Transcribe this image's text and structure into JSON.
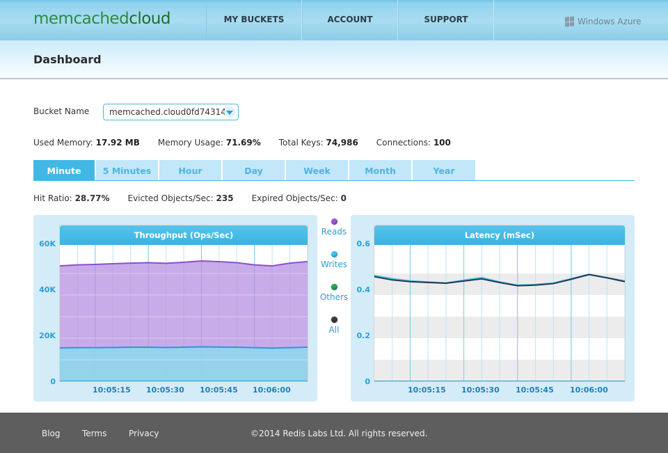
{
  "header": {
    "logo_part1": "memcached",
    "logo_part2": "cloud",
    "nav": [
      {
        "label": "MY BUCKETS"
      },
      {
        "label": "ACCOUNT"
      },
      {
        "label": "SUPPORT"
      }
    ],
    "partner": "Windows Azure"
  },
  "page": {
    "title": "Dashboard"
  },
  "bucket": {
    "label": "Bucket Name",
    "selected": "memcached.cloud0fd74314-"
  },
  "stats": {
    "used_memory_label": "Used Memory:",
    "used_memory_value": "17.92 MB",
    "memory_usage_label": "Memory Usage:",
    "memory_usage_value": "71.69%",
    "total_keys_label": "Total Keys:",
    "total_keys_value": "74,986",
    "connections_label": "Connections:",
    "connections_value": "100"
  },
  "tabs": [
    {
      "label": "Minute",
      "active": true
    },
    {
      "label": "5 Minutes",
      "active": false
    },
    {
      "label": "Hour",
      "active": false
    },
    {
      "label": "Day",
      "active": false
    },
    {
      "label": "Week",
      "active": false
    },
    {
      "label": "Month",
      "active": false
    },
    {
      "label": "Year",
      "active": false
    }
  ],
  "ratios": {
    "hit_ratio_label": "Hit Ratio:",
    "hit_ratio_value": "28.77%",
    "evicted_label": "Evicted Objects/Sec:",
    "evicted_value": "235",
    "expired_label": "Expired Objects/Sec:",
    "expired_value": "0"
  },
  "legend": [
    {
      "label": "Reads",
      "color": "#9b59d6"
    },
    {
      "label": "Writes",
      "color": "#3cc4ec"
    },
    {
      "label": "Others",
      "color": "#27a55b"
    },
    {
      "label": "All",
      "color": "#3a3a3a"
    }
  ],
  "chart_data": [
    {
      "type": "area",
      "title": "Throughput (Ops/Sec)",
      "ylim": [
        0,
        60000
      ],
      "yticks": [
        "0",
        "20K",
        "40K",
        "60K"
      ],
      "xticks": [
        "10:05:15",
        "10:05:30",
        "10:05:45",
        "10:06:00"
      ],
      "x": [
        0,
        1,
        2,
        3,
        4,
        5,
        6,
        7,
        8,
        9,
        10,
        11,
        12,
        13,
        14
      ],
      "series": [
        {
          "name": "Reads",
          "color": "#9b59d6",
          "values": [
            53500,
            54000,
            54200,
            54500,
            54800,
            55000,
            54700,
            55200,
            55800,
            55500,
            55000,
            54000,
            53500,
            54800,
            55500
          ]
        },
        {
          "name": "Writes",
          "color": "#3c8fd9",
          "values": [
            15500,
            15600,
            15600,
            15700,
            15800,
            15800,
            15700,
            15800,
            16000,
            15900,
            15800,
            15600,
            15400,
            15600,
            15800
          ]
        }
      ],
      "grid": true
    },
    {
      "type": "line",
      "title": "Latency (mSec)",
      "ylim": [
        0,
        0.6
      ],
      "yticks": [
        "0",
        "0.2",
        "0.4",
        "0.6"
      ],
      "xticks": [
        "10:05:15",
        "10:05:30",
        "10:05:45",
        "10:06:00"
      ],
      "x": [
        0,
        1,
        2,
        3,
        4,
        5,
        6,
        7,
        8,
        9,
        10,
        11,
        12,
        13,
        14
      ],
      "series": [
        {
          "name": "Writes",
          "color": "#3cc4ec",
          "values": [
            0.49,
            0.475,
            0.465,
            0.46,
            0.455,
            0.468,
            0.48,
            0.46,
            0.445,
            0.448,
            0.455,
            0.475,
            0.495,
            0.48,
            0.465
          ]
        },
        {
          "name": "All",
          "color": "#2d3550",
          "values": [
            0.485,
            0.47,
            0.462,
            0.458,
            0.455,
            0.465,
            0.475,
            0.458,
            0.443,
            0.446,
            0.453,
            0.473,
            0.495,
            0.48,
            0.462
          ]
        }
      ],
      "grid": true
    }
  ],
  "footer": {
    "links": [
      {
        "label": "Blog"
      },
      {
        "label": "Terms"
      },
      {
        "label": "Privacy"
      }
    ],
    "copyright": "©2014 Redis Labs Ltd. All rights reserved."
  }
}
